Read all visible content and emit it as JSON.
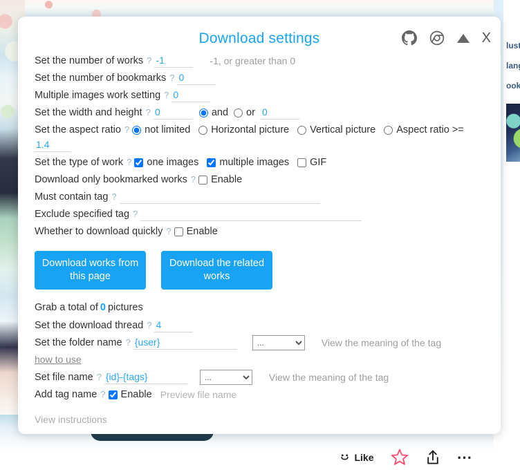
{
  "background": {
    "rail_links": [
      "lustr",
      "lang",
      "ookm"
    ],
    "action_bar": {
      "like_label": "Like",
      "like_icon": "smiley-icon",
      "bookmark_icon": "star-icon",
      "share_icon": "share-icon",
      "more_icon": "ellipsis-icon"
    }
  },
  "modal": {
    "title": "Download settings",
    "header_icons": [
      {
        "name": "github-icon",
        "label": "GitHub"
      },
      {
        "name": "chrome-icon",
        "label": "Chrome"
      },
      {
        "name": "collapse-triangle-icon",
        "label": "Collapse"
      },
      {
        "name": "close-icon",
        "label": "X"
      }
    ],
    "close_label": "X",
    "rows": {
      "works": {
        "label": "Set the number of works",
        "value": "-1",
        "hint": "-1, or greater than 0"
      },
      "bookmarks": {
        "label": "Set the number of bookmarks",
        "value": "0"
      },
      "multiple_images": {
        "label": "Multiple images work setting",
        "value": "0"
      },
      "width_height": {
        "label": "Set the width and height",
        "width_value": "0",
        "and_label": "and",
        "or_label": "or",
        "height_value": "0",
        "selected": "and"
      },
      "aspect_ratio": {
        "label": "Set the aspect ratio",
        "options": [
          "not limited",
          "Horizontal picture",
          "Vertical picture",
          "Aspect ratio >="
        ],
        "selected": "not limited",
        "ratio_value": "1.4"
      },
      "work_type": {
        "label": "Set the type of work",
        "options": [
          {
            "label": "one images",
            "checked": true
          },
          {
            "label": "multiple images",
            "checked": true
          },
          {
            "label": "GIF",
            "checked": false
          }
        ]
      },
      "bookmarked_only": {
        "label": "Download only bookmarked works",
        "enable_label": "Enable",
        "checked": false
      },
      "must_contain_tag": {
        "label": "Must contain tag",
        "value": "",
        "placeholder": ""
      },
      "exclude_tag": {
        "label": "Exclude specified tag",
        "value": "",
        "placeholder": ""
      },
      "download_quickly": {
        "label": "Whether to download quickly",
        "enable_label": "Enable",
        "checked": false
      }
    },
    "buttons": {
      "download_page": "Download works from this page",
      "download_related": "Download the related works"
    },
    "total": {
      "prefix": "Grab a total of",
      "count": "0",
      "suffix": "pictures"
    },
    "thread": {
      "label": "Set the download thread",
      "value": "4"
    },
    "folder_name": {
      "label": "Set the folder name",
      "value": "{user}",
      "select_value": "...",
      "tag_meaning_link": "View the meaning of the tag",
      "how_to_use": "how to use"
    },
    "file_name": {
      "label": "Set file name",
      "value": "{id}-{tags}",
      "select_value": "...",
      "tag_meaning_link": "View the meaning of the tag"
    },
    "add_tag_name": {
      "label": "Add tag name",
      "enable_label": "Enable",
      "checked": true,
      "preview_link": "Preview file name"
    },
    "view_instructions": "View instructions"
  },
  "colors": {
    "accent": "#18a3f5",
    "input_text": "#2aa9ee",
    "muted": "#9e9e9e",
    "star": "#ff4060"
  }
}
